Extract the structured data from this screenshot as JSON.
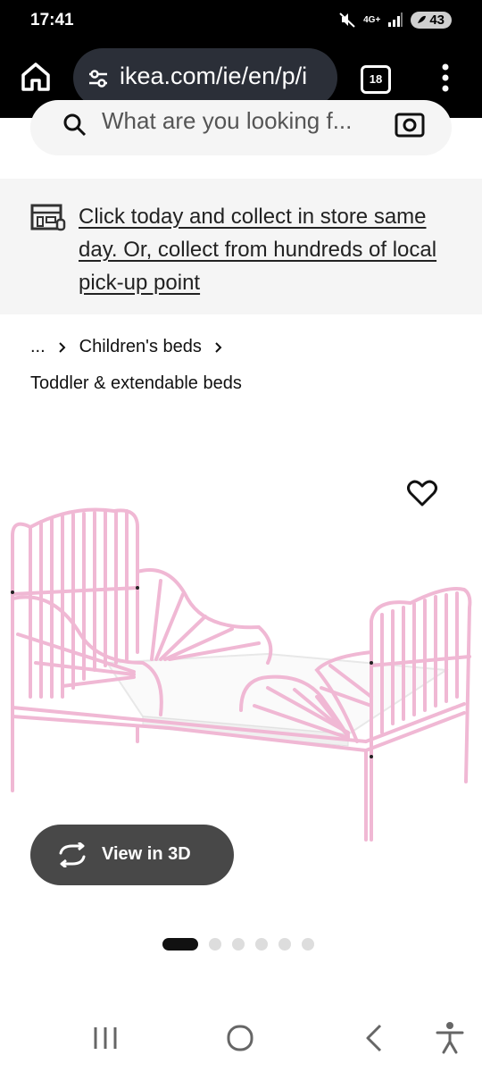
{
  "status": {
    "time": "17:41",
    "network": "4G+",
    "battery": "43"
  },
  "browser": {
    "url": "ikea.com/ie/en/p/i",
    "tab_count": "18"
  },
  "search": {
    "placeholder": "What are you looking f..."
  },
  "banner": {
    "text": "Click today and collect in store same day. Or, collect from hundreds of local pick-up point"
  },
  "breadcrumb": {
    "ellipsis": "...",
    "item": "Children's beds",
    "current": "Toddler & extendable beds"
  },
  "product": {
    "view3d_label": "View in 3D",
    "image_count": 6,
    "active_image": 1
  },
  "icons": [
    "home-icon",
    "tune-icon",
    "tabs-icon",
    "more-vert-icon",
    "search-icon",
    "camera-icon",
    "store-icon",
    "heart-icon",
    "rotate-3d-icon",
    "recents-icon",
    "home-nav-icon",
    "back-icon",
    "accessibility-icon"
  ],
  "colors": {
    "bed_pink": "#f0b8d4",
    "button_dark": "#484848",
    "banner_bg": "#f5f5f5"
  }
}
